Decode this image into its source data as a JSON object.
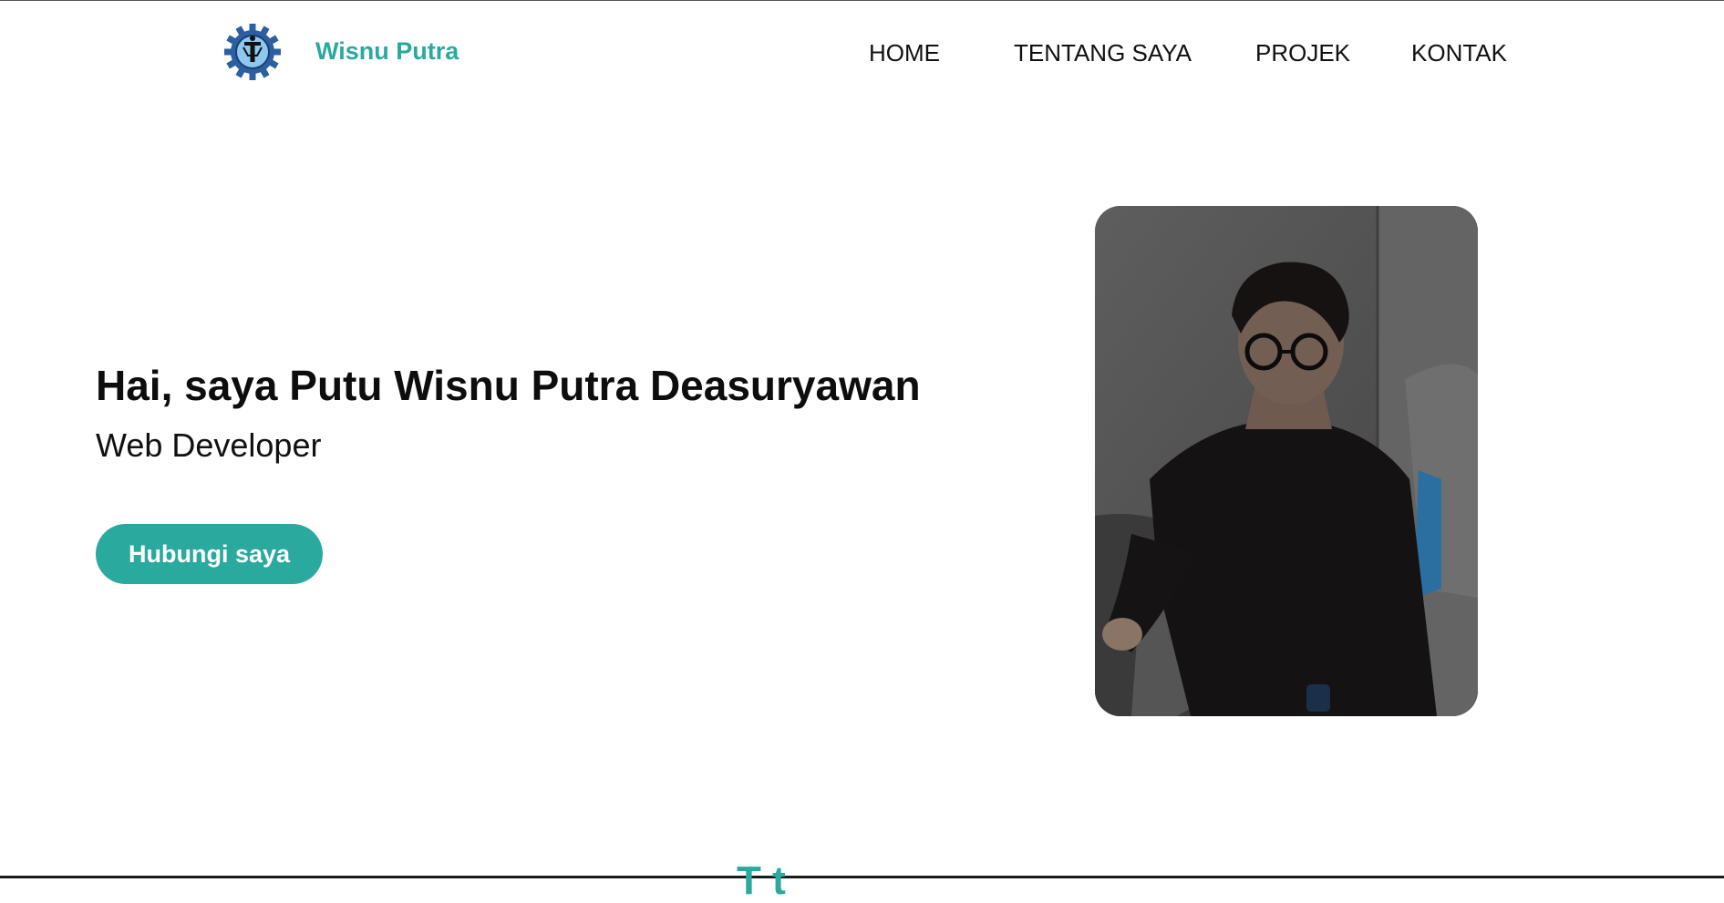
{
  "header": {
    "brand": "Wisnu Putra",
    "logo_icon": "gear-logo-icon",
    "nav": [
      {
        "label": "HOME"
      },
      {
        "label": "TENTANG SAYA"
      },
      {
        "label": "PROJEK"
      },
      {
        "label": "KONTAK"
      }
    ]
  },
  "hero": {
    "title": "Hai, saya Putu Wisnu Putra Deasuryawan",
    "subtitle": "Web Developer",
    "cta_label": "Hubungi saya"
  },
  "photo": {
    "icon": "profile-photo"
  },
  "next_section": {
    "heading_fragment": "T t"
  },
  "colors": {
    "accent": "#2aa99f",
    "text": "#111111",
    "background": "#ffffff",
    "logo_blue": "#2b5fa0"
  }
}
